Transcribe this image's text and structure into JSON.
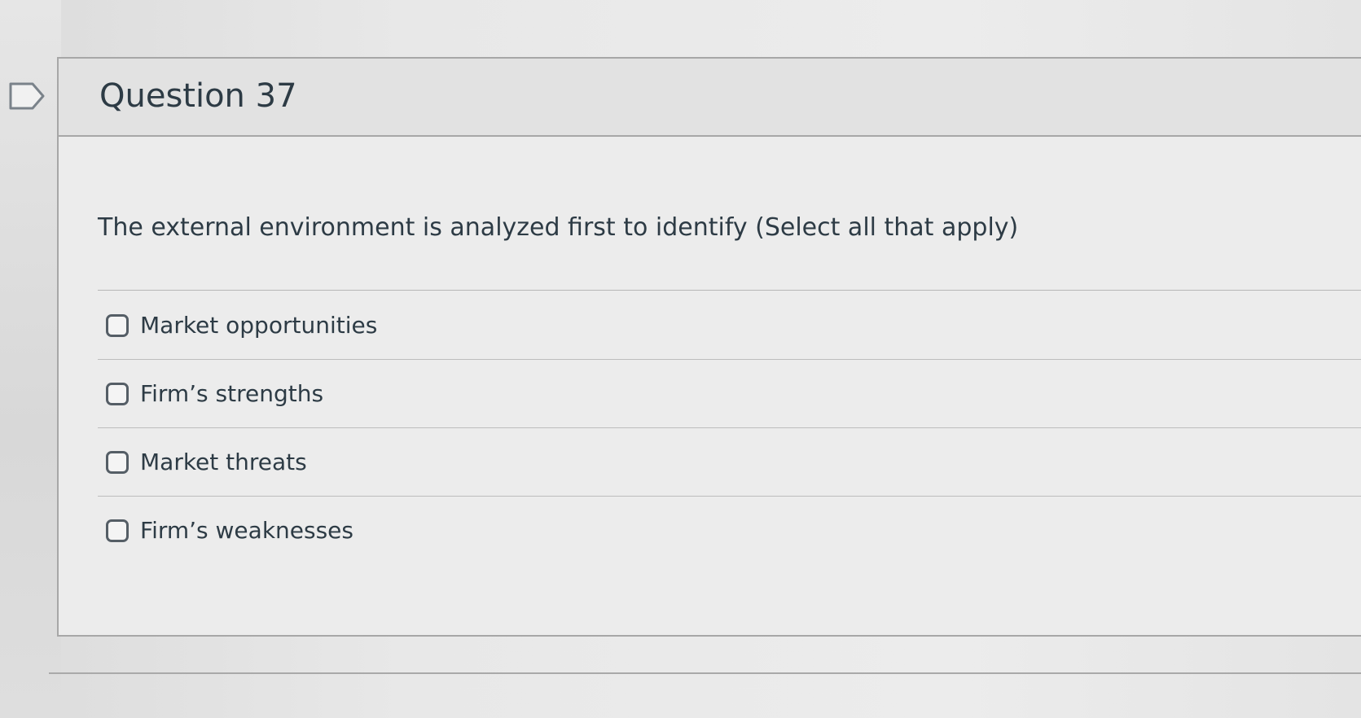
{
  "question": {
    "title": "Question 37",
    "text": "The external environment is analyzed first to identify (Select all that apply)",
    "answers": [
      {
        "label": "Market opportunities",
        "checked": false
      },
      {
        "label": "Firm’s strengths",
        "checked": false
      },
      {
        "label": "Market threats",
        "checked": false
      },
      {
        "label": "Firm’s weaknesses",
        "checked": false
      }
    ]
  },
  "icons": {
    "flag": "flag-question-icon",
    "checkbox": "checkbox-unchecked-icon"
  },
  "colors": {
    "text": "#2d3b45",
    "border": "#a7a7a7",
    "header_background": "#e2e2e2"
  }
}
